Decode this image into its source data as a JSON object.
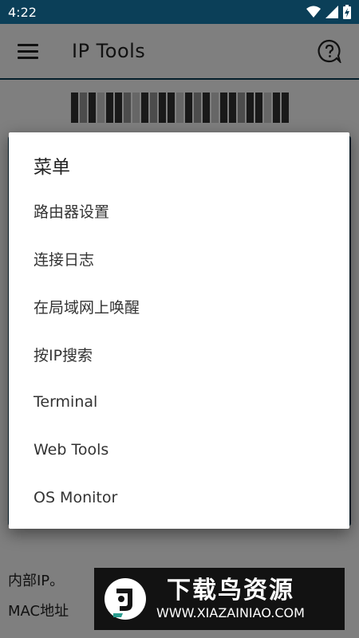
{
  "status_bar": {
    "time": "4:22",
    "icons": [
      "wifi-icon",
      "signal-icon",
      "battery-charging-icon"
    ]
  },
  "toolbar": {
    "menu_icon": "hamburger-menu-icon",
    "title": "IP Tools",
    "help_icon": "help-chat-icon"
  },
  "background": {
    "list_items": [
      {
        "label": "内部IP。"
      },
      {
        "label": "MAC地址"
      }
    ]
  },
  "dialog": {
    "title": "菜单",
    "items": [
      {
        "label": "路由器设置"
      },
      {
        "label": "连接日志"
      },
      {
        "label": "在局域网上唤醒"
      },
      {
        "label": "按IP搜索"
      },
      {
        "label": "Terminal"
      },
      {
        "label": "Web Tools"
      },
      {
        "label": "OS Monitor"
      }
    ]
  },
  "watermark": {
    "brand_cn": "下载鸟资源",
    "url": "WWW.XIAZAINIAO.COM"
  },
  "colors": {
    "primary": "#0b3f58",
    "scrim": "#000000",
    "dialog_bg": "#ffffff",
    "watermark_bg": "#121212",
    "watermark_accent": "#ffffff"
  }
}
